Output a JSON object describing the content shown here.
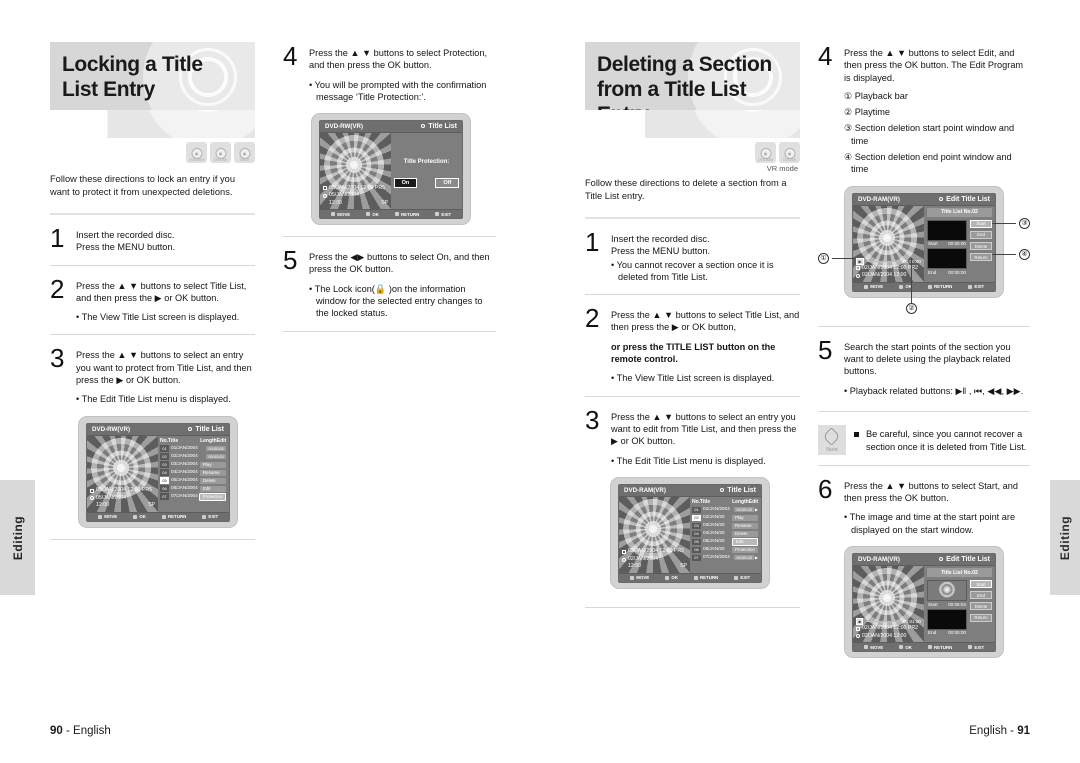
{
  "sidetabs": {
    "left_label": "Editing",
    "right_label": "Editing"
  },
  "footer": {
    "left": "90",
    "left_lang": "English",
    "right_lang": "English",
    "right": "91"
  },
  "columns": {
    "c1": {
      "title": "Locking a Title List Entry",
      "badges": [
        {
          "name": "dvd-ram-badge",
          "text": "DVD-RAM"
        },
        {
          "name": "dvd-rw-badge",
          "text": "DVD-RW"
        },
        {
          "name": "dvd-r-badge",
          "text": "DVD-R"
        }
      ],
      "intro": "Follow these directions to lock an entry if you want to protect it from unexpected deletions.",
      "steps": [
        {
          "num": "1",
          "lines": [
            "Insert the recorded disc.",
            "Press the MENU button."
          ]
        },
        {
          "num": "2",
          "lines": [
            "Press the ▲ ▼ buttons to select Title List, and then press the ▶ or OK button."
          ],
          "bullet": "• The View Title List screen is displayed."
        },
        {
          "num": "3",
          "lines": [
            "Press the ▲ ▼ buttons to select an entry you want to protect from Title List, and then press the ▶ or OK button."
          ],
          "bullet": "• The Edit Title List menu is displayed."
        }
      ],
      "tv": {
        "disc_label": "DVD-RW(VR)",
        "screen_title": "Title List",
        "info_line1": "05/JAN/2004 12:00 PR5",
        "info_line2": "05/JAN/2004",
        "info_time": "12:00",
        "info_mode": "SP",
        "headers": {
          "no": "No.",
          "title": "Title",
          "length": "Length",
          "edit": "Edit"
        },
        "rows": [
          {
            "no": "01",
            "title": "01/JAN/2004",
            "length": "00:00:01",
            "menu": "",
            "selected": false
          },
          {
            "no": "02",
            "title": "02/JAN/2004",
            "length": "00:00:01",
            "menu": "",
            "selected": false
          },
          {
            "no": "03",
            "title": "03/JAN/2004",
            "length": "",
            "menu": "Play",
            "selected": false
          },
          {
            "no": "04",
            "title": "04/JAN/2004",
            "length": "",
            "menu": "Rename",
            "selected": false
          },
          {
            "no": "05",
            "title": "05/JAN/2004",
            "length": "",
            "menu": "Delete",
            "selected": true
          },
          {
            "no": "06",
            "title": "06/JAN/2004",
            "length": "",
            "menu": "Edit",
            "selected": false
          },
          {
            "no": "07",
            "title": "07/JAN/2004",
            "length": "",
            "menu": "Protection",
            "selected": false,
            "highlight": true
          }
        ],
        "footer": [
          "MOVE",
          "OK",
          "RETURN",
          "EXIT"
        ]
      }
    },
    "c2": {
      "steps": [
        {
          "num": "4",
          "lines": [
            "Press the ▲ ▼ buttons to select Protection, and then press the OK button."
          ],
          "bullet": "• You will be prompted with the confirmation message ‘Title Protection:’."
        },
        {
          "num": "5",
          "lines": [
            "Press the ◀▶ buttons to select On, and then press the OK button."
          ],
          "bullet": "• The Lock icon(🔒 )on the information window for the selected entry changes to the locked status."
        }
      ],
      "tv": {
        "disc_label": "DVD-RW(VR)",
        "screen_title": "Title List",
        "prompt": "Title Protection:",
        "btn_on": "On",
        "btn_off": "Off",
        "info_line1": "05/JAN/2004 12:00 PR5",
        "info_line2": "05/JAN/2004",
        "info_time": "12:00",
        "info_mode": "SP",
        "footer": [
          "MOVE",
          "OK",
          "RETURN",
          "EXIT"
        ]
      }
    },
    "c3": {
      "title": "Deleting a Section from a Title List Entry",
      "badges": [
        {
          "name": "dvd-ram-badge",
          "text": "DVD-RAM"
        },
        {
          "name": "dvd-rw-badge",
          "text": "DVD-RW"
        }
      ],
      "vr_mode": "VR mode",
      "intro": "Follow these directions to delete a section from a Title List entry.",
      "steps": [
        {
          "num": "1",
          "lines": [
            "Insert the recorded disc.",
            "Press the MENU button."
          ],
          "bullet": "• You cannot recover a section once it is deleted from Title List."
        },
        {
          "num": "2",
          "lines": [
            "Press the ▲ ▼ buttons to select Title List, and then press the ▶ or OK button,"
          ],
          "strong": "or press the TITLE LIST button on the remote control.",
          "bullet": "• The View Title List screen is displayed."
        },
        {
          "num": "3",
          "lines": [
            "Press the ▲ ▼ buttons to select an entry you want to edit from Title List, and then press the ▶ or OK button."
          ],
          "bullet": "• The Edit Title List menu is displayed."
        }
      ],
      "tv": {
        "disc_label": "DVD-RAM(VR)",
        "screen_title": "Title List",
        "info_line1": "02/JAN/2004 12:00 PR2",
        "info_line2": "02/JAN/2004",
        "info_time": "12:00",
        "info_mode": "SP",
        "headers": {
          "no": "No.",
          "title": "Title",
          "length": "Length",
          "edit": "Edit"
        },
        "rows": [
          {
            "no": "01",
            "title": "01/JAN/2004",
            "length": "00:00:20",
            "menu": "",
            "selected": false,
            "arrow": true
          },
          {
            "no": "02",
            "title": "02/JAN/20",
            "length": "",
            "menu": "Play",
            "selected": true
          },
          {
            "no": "03",
            "title": "03/JAN/20",
            "length": "",
            "menu": "Rename",
            "selected": false
          },
          {
            "no": "04",
            "title": "04/JAN/20",
            "length": "",
            "menu": "Delete",
            "selected": false
          },
          {
            "no": "05",
            "title": "05/JAN/20",
            "length": "",
            "menu": "Edit",
            "selected": false,
            "highlight": true
          },
          {
            "no": "06",
            "title": "06/JAN/20",
            "length": "",
            "menu": "Protection",
            "selected": false
          },
          {
            "no": "07",
            "title": "07/JAN/2004",
            "length": "00:00:20",
            "menu": "",
            "selected": false,
            "arrow": true
          }
        ],
        "footer": [
          "MOVE",
          "OK",
          "RETURN",
          "EXIT"
        ]
      }
    },
    "c4": {
      "steps": [
        {
          "num": "4",
          "lines": [
            "Press the ▲ ▼ buttons to select Edit, and then press the OK button. The Edit Program is displayed."
          ],
          "list": [
            "① Playback bar",
            "② Playtime",
            "③ Section deletion start point window and time",
            "④ Section deletion end point window and time"
          ]
        },
        {
          "num": "5",
          "lines": [
            "Search the start points of the section you want to delete using the playback related buttons."
          ],
          "bullet": "• Playback related buttons: ▶‖ , ⏮, ◀◀, ▶▶."
        },
        {
          "num": "6",
          "lines": [
            "Press the ▲ ▼ buttons to select Start, and then press the OK button."
          ],
          "bullet": "• The image and time at the start point are displayed on the start window."
        }
      ],
      "note": "Be careful, since you cannot recover a section once it is deleted from Title List.",
      "note_label": "Note",
      "callouts": [
        "①",
        "②",
        "③",
        "④"
      ],
      "tv_a": {
        "disc_label": "DVD-RAM(VR)",
        "screen_title": "Edit Title List",
        "list_title": "Title List No.02",
        "start_label": "Start",
        "start_time": "00:00:00",
        "end_label": "End",
        "end_time": "00:00:00",
        "playtime": "00:00:00",
        "buttons": [
          "Start",
          "End",
          "Delete",
          "Return"
        ],
        "info_line1": "02/JAN/2004 12:00 PR2",
        "info_line2": "02/JAN/2004 12:00",
        "footer": [
          "MOVE",
          "OK",
          "RETURN",
          "EXIT"
        ]
      },
      "tv_b": {
        "disc_label": "DVD-RAM(VR)",
        "screen_title": "Edit Title List",
        "list_title": "Title List No.02",
        "start_label": "Start",
        "start_time": "00:08:04",
        "end_label": "End",
        "end_time": "00:00:00",
        "playtime": "00:01:00",
        "buttons": [
          "Start",
          "End",
          "Delete",
          "Return"
        ],
        "info_line1": "02/JAN/2004 12:00 PR2",
        "info_line2": "02/JAN/2004 12:00",
        "footer": [
          "MOVE",
          "OK",
          "RETURN",
          "EXIT"
        ]
      }
    }
  }
}
